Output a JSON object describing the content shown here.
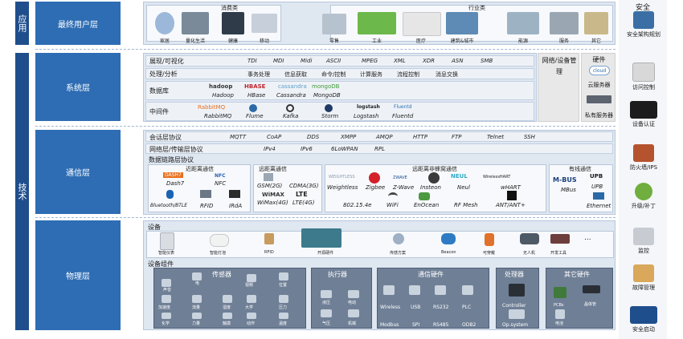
{
  "left_labels": {
    "app": "应用",
    "tech": "技术"
  },
  "layers": {
    "end_user": "最终用户层",
    "system": "系统层",
    "comm": "通信层",
    "physical": "物理层"
  },
  "end_user": {
    "consumer_title": "消费类",
    "industry_title": "行业类",
    "items": [
      "家居",
      "量化生活",
      "健康",
      "移动",
      "零售",
      "工业",
      "医疗",
      "建筑&城市",
      "能源",
      "服务",
      "其它"
    ]
  },
  "system": {
    "rows": [
      {
        "label": "展现/可视化",
        "items": [
          "TDI",
          "MDI",
          "Midi",
          "ASCII",
          "MPEG",
          "XML",
          "XDR",
          "ASN",
          "SMB"
        ]
      },
      {
        "label": "处理/分析",
        "items": [
          "事务处理",
          "信息获取",
          "命令/控制",
          "计算服务",
          "流程控制",
          "消息交换"
        ]
      },
      {
        "label": "数据库",
        "items": [
          "Hadoop",
          "HBase",
          "Cassandra",
          "MongoDB"
        ]
      },
      {
        "label": "中间件",
        "items": [
          "RabbitMQ",
          "Flume",
          "Kafka",
          "Storm",
          "Logstash",
          "Fluentd"
        ]
      }
    ],
    "logos": {
      "hadoop": "hadoop",
      "hbase": "HBASE",
      "cassandra": "cassandra",
      "mongodb": "mongoDB",
      "rabbitmq": "RabbitMQ",
      "logstash": "logstash",
      "fluentd": "Fluentd"
    },
    "net_mgmt": "网络/设备管理",
    "hardware_title": "硬件",
    "cloud_logo": "cloud",
    "cloud_server": "云服务器",
    "private_server": "私有服务器"
  },
  "comm": {
    "session": {
      "label": "会话层协议",
      "items": [
        "MQTT",
        "CoAP",
        "DDS",
        "XMPP",
        "AMQP",
        "HTTP",
        "FTP",
        "Telnet",
        "SSH"
      ]
    },
    "network": {
      "label": "网络层/传输层协议",
      "items": [
        "IPv4",
        "IPv6",
        "6LoWPAN",
        "RPL"
      ]
    },
    "datalink": {
      "label": "数据链路层协议"
    },
    "near": {
      "title": "近距离通信",
      "items": [
        "Dash7",
        "NFC",
        "Bluetooth/BTLE",
        "RFID",
        "IRdA"
      ],
      "logos": {
        "dash7": "DASH7",
        "nfc": "NFC"
      }
    },
    "far": {
      "title": "远距离通信",
      "items": [
        "GSM(2G)",
        "CDMA(3G)",
        "WiMax(4G)",
        "LTE(4G)"
      ],
      "logos": {
        "wimax": "WiMAX",
        "lte": "LTE"
      }
    },
    "wireless": {
      "title": "远距离非蜂窝通信",
      "items": [
        "Weightless",
        "Zigbee",
        "Z-Wave",
        "Insteon",
        "Neul",
        "wHART",
        "802.15.4e",
        "WiFi",
        "EnOcean",
        "RF Mesh",
        "ANT/ANT+"
      ],
      "logos": {
        "weightless": "WEIGHTLESS",
        "zwave": "ZWAVE",
        "neul": "NEUL",
        "whart": "WirelessHART"
      }
    },
    "wired": {
      "title": "有线通信",
      "items": [
        "MBus",
        "UPB",
        "Ethernet"
      ],
      "logos": {
        "mbus": "M-BUS",
        "upb": "UPB"
      }
    }
  },
  "physical": {
    "devices_label": "设备",
    "devices": [
      "智能仪表",
      "智能灯泡",
      "RFID",
      "开源硬件",
      "传感方案",
      "Beacon",
      "可穿戴",
      "无人机",
      "开发工具"
    ],
    "more": "...",
    "components_label": "设备组件",
    "sensors": {
      "title": "传感器",
      "items": [
        "声音",
        "电",
        "视频",
        "位置",
        "加速度",
        "流量",
        "湿度",
        "大学",
        "压力",
        "化学",
        "力量",
        "触摸",
        "动作",
        "温度"
      ]
    },
    "actuators": {
      "title": "执行器",
      "items": [
        "液压",
        "电动",
        "气压",
        "机械"
      ]
    },
    "comm_hw": {
      "title": "通信硬件",
      "items": [
        "Wireless",
        "USB",
        "RS232",
        "PLC",
        "Modbus",
        "SPI",
        "RS485",
        "ODB2"
      ]
    },
    "processor": {
      "title": "处理器",
      "items": [
        "Controller",
        "Op.system"
      ]
    },
    "other_hw": {
      "title": "其它硬件",
      "items": [
        "PCBs",
        "晶体管",
        "电池"
      ]
    }
  },
  "security": {
    "title": "安全",
    "items": [
      "安全架构规划",
      "访问控制",
      "设备认证",
      "防火墙/IPS",
      "升级/补丁",
      "监控",
      "故障管理",
      "安全启动"
    ]
  }
}
